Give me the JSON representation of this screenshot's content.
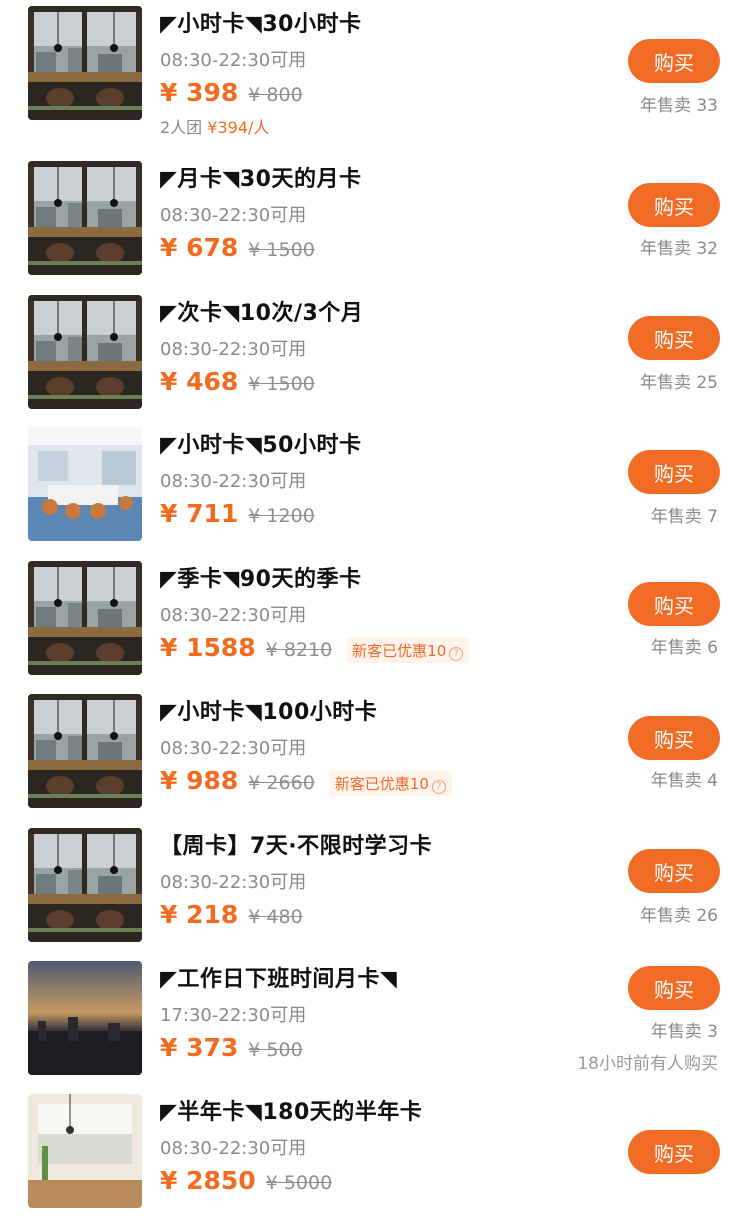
{
  "accent_color": "#f06c24",
  "items": [
    {
      "title": "◤小时卡◥30小时卡",
      "hours": "08:30-22:30可用",
      "price": "¥ 398",
      "orig": "¥ 800",
      "promo": "",
      "group": "2人团 ",
      "group_price": "¥394/人",
      "buy": "购买",
      "sold": "年售卖 33",
      "recent": "",
      "img": "room"
    },
    {
      "title": "◤月卡◥30天的月卡",
      "hours": "08:30-22:30可用",
      "price": "¥ 678",
      "orig": "¥ 1500",
      "promo": "",
      "group": "",
      "group_price": "",
      "buy": "购买",
      "sold": "年售卖 32",
      "recent": "",
      "img": "room"
    },
    {
      "title": "◤次卡◥10次/3个月",
      "hours": "08:30-22:30可用",
      "price": "¥ 468",
      "orig": "¥ 1500",
      "promo": "",
      "group": "",
      "group_price": "",
      "buy": "购买",
      "sold": "年售卖 25",
      "recent": "",
      "img": "room"
    },
    {
      "title": "◤小时卡◥50小时卡",
      "hours": "08:30-22:30可用",
      "price": "¥ 711",
      "orig": "¥ 1200",
      "promo": "",
      "group": "",
      "group_price": "",
      "buy": "购买",
      "sold": "年售卖 7",
      "recent": "",
      "img": "office"
    },
    {
      "title": "◤季卡◥90天的季卡",
      "hours": "08:30-22:30可用",
      "price": "¥ 1588",
      "orig": "¥ 8210",
      "promo": "新客已优惠10",
      "group": "",
      "group_price": "",
      "buy": "购买",
      "sold": "年售卖 6",
      "recent": "",
      "img": "room"
    },
    {
      "title": "◤小时卡◥100小时卡",
      "hours": "08:30-22:30可用",
      "price": "¥ 988",
      "orig": "¥ 2660",
      "promo": "新客已优惠10",
      "group": "",
      "group_price": "",
      "buy": "购买",
      "sold": "年售卖 4",
      "recent": "",
      "img": "room"
    },
    {
      "title": "【周卡】7天·不限时学习卡",
      "hours": "08:30-22:30可用",
      "price": "¥ 218",
      "orig": "¥ 480",
      "promo": "",
      "group": "",
      "group_price": "",
      "buy": "购买",
      "sold": "年售卖 26",
      "recent": "",
      "img": "room"
    },
    {
      "title": "◤工作日下班时间月卡◥",
      "hours": "17:30-22:30可用",
      "price": "¥ 373",
      "orig": "¥ 500",
      "promo": "",
      "group": "",
      "group_price": "",
      "buy": "购买",
      "sold": "年售卖 3",
      "recent": "18小时前有人购买",
      "img": "dusk"
    },
    {
      "title": "◤半年卡◥180天的半年卡",
      "hours": "08:30-22:30可用",
      "price": "¥ 2850",
      "orig": "¥ 5000",
      "promo": "",
      "group": "",
      "group_price": "",
      "buy": "购买",
      "sold": "",
      "recent": "",
      "img": "bright"
    }
  ]
}
